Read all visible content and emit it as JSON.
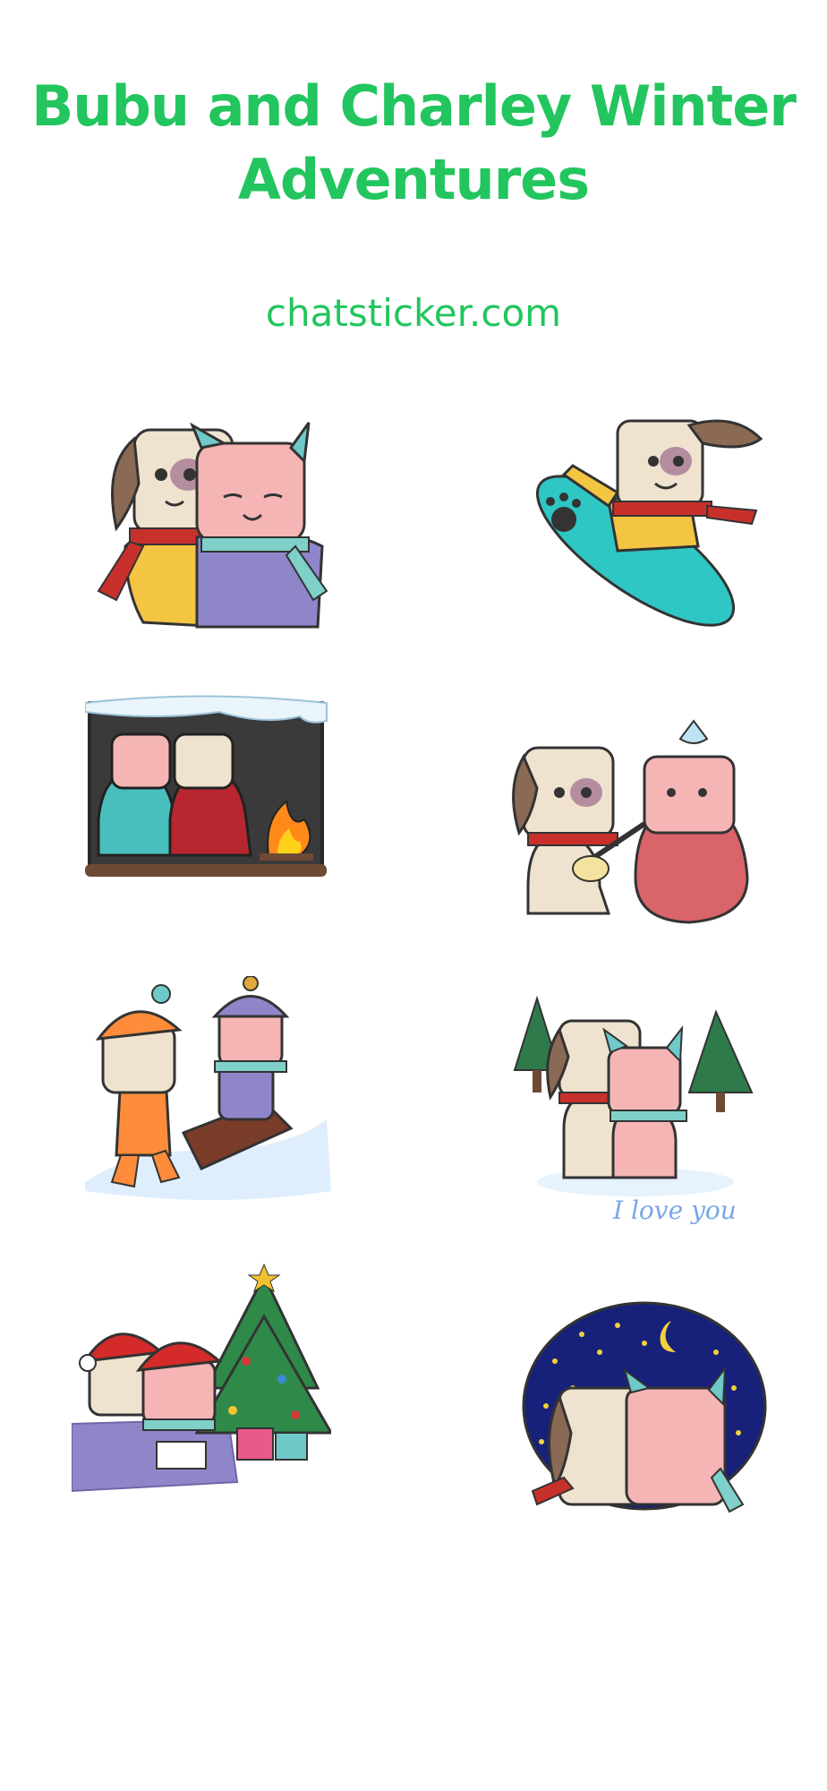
{
  "header": {
    "title_line1": "Bubu and Charley Winter",
    "title_line2": "Adventures",
    "site": "chatsticker.com",
    "accent_color": "#22c55e"
  },
  "stickers": [
    {
      "name": "hug-in-scarves"
    },
    {
      "name": "snowboard-jump"
    },
    {
      "name": "fireplace-blankets"
    },
    {
      "name": "feeding-sick-friend"
    },
    {
      "name": "sled-pull"
    },
    {
      "name": "snowy-hug",
      "caption": "I love you"
    },
    {
      "name": "christmas-gifts"
    },
    {
      "name": "starry-night"
    }
  ]
}
